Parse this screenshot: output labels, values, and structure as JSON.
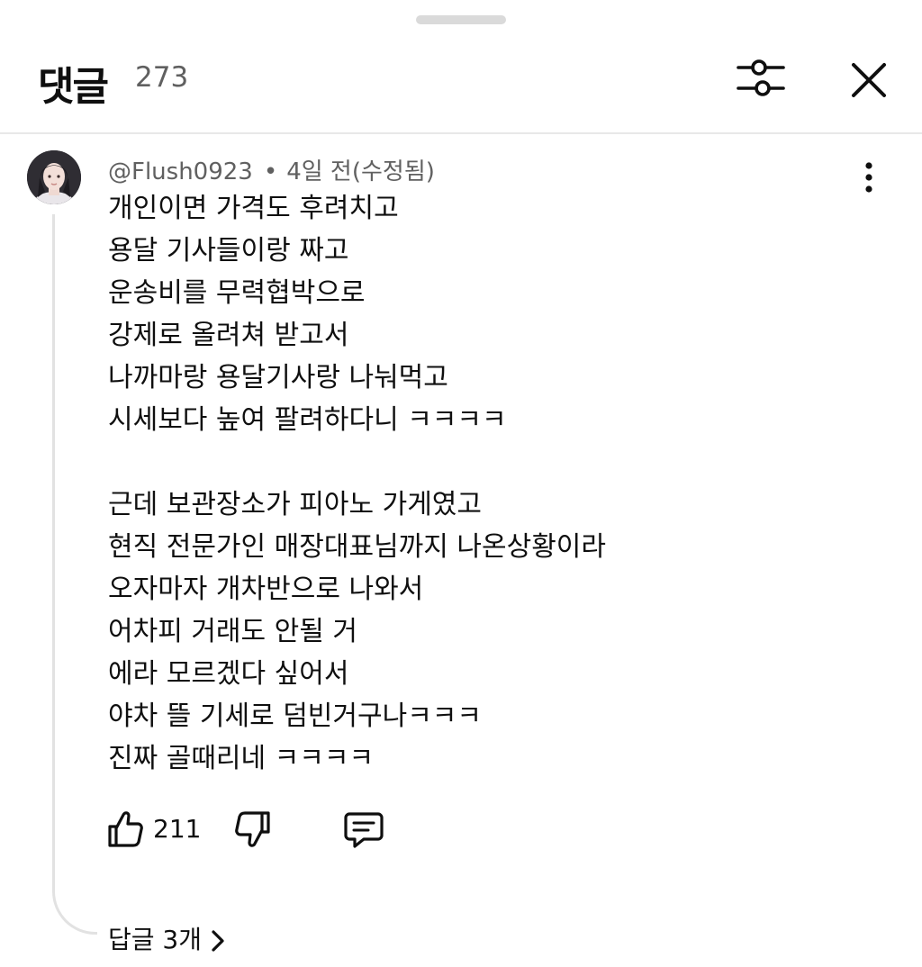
{
  "header": {
    "title": "댓글",
    "count": "273"
  },
  "comment": {
    "author": "@Flush0923",
    "separator": "•",
    "time": "4일 전(수정됨)",
    "lines": [
      "개인이면 가격도 후려치고",
      "용달 기사들이랑 짜고",
      "운송비를 무력협박으로",
      "강제로 올려쳐 받고서",
      "나까마랑 용달기사랑 나눠먹고",
      "시세보다 높여 팔려하다니 ㅋㅋㅋㅋ",
      "",
      "근데 보관장소가 피아노 가게였고",
      "현직 전문가인 매장대표님까지 나온상황이라",
      "오자마자 개차반으로 나와서",
      "어차피 거래도 안될 거",
      "에라 모르겠다 싶어서",
      "야차 뜰 기세로 덤빈거구나ㅋㅋㅋ",
      "진짜 골때리네 ㅋㅋㅋㅋ"
    ],
    "likes": "211",
    "replies_label": "답글 3개"
  },
  "icons": {
    "filter": "sliders-icon",
    "close": "close-icon",
    "more": "more-vertical-icon",
    "like": "thumbs-up-icon",
    "dislike": "thumbs-down-icon",
    "reply": "comment-icon",
    "expand": "chevron-right-icon"
  },
  "colors": {
    "text": "#0f0f0f",
    "secondary": "#606060",
    "divider": "#e8e8e8"
  }
}
